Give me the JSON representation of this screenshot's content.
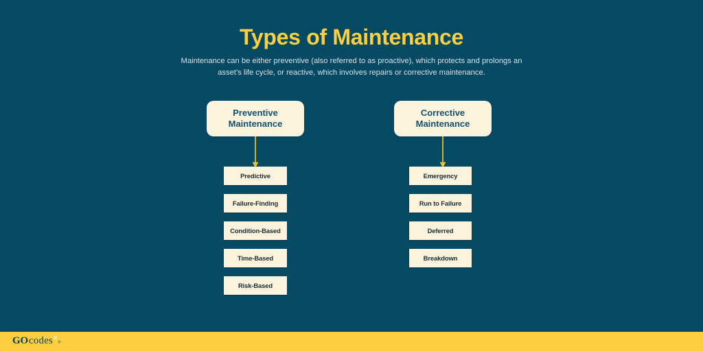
{
  "colors": {
    "background": "#064963",
    "accent_yellow": "#FCCF3F",
    "box_cream": "#FBF3DC",
    "heading_text": "#13506B",
    "body_text": "#D9E3E8",
    "child_text": "#1A2B33",
    "connector": "#D4B122"
  },
  "header": {
    "title": "Types of Maintenance",
    "subtitle": "Maintenance can be either preventive (also referred to as proactive), which protects and prolongs an asset’s life cycle, or reactive, which involves repairs or corrective maintenance."
  },
  "branches": [
    {
      "id": "preventive",
      "label": "Preventive Maintenance",
      "label_line1": "Preventive",
      "label_line2": "Maintenance",
      "children": [
        {
          "label": "Predictive"
        },
        {
          "label": "Failure-Finding"
        },
        {
          "label": "Condition-Based"
        },
        {
          "label": "Time-Based"
        },
        {
          "label": "Risk-Based"
        }
      ]
    },
    {
      "id": "corrective",
      "label": "Corrective Maintenance",
      "label_line1": "Corrective",
      "label_line2": "Maintenance",
      "children": [
        {
          "label": "Emergency"
        },
        {
          "label": "Run to Failure"
        },
        {
          "label": "Deferred"
        },
        {
          "label": "Breakdown"
        }
      ]
    }
  ],
  "footer": {
    "logo_primary": "GO",
    "logo_secondary": "codes",
    "logo_registered": "®"
  }
}
